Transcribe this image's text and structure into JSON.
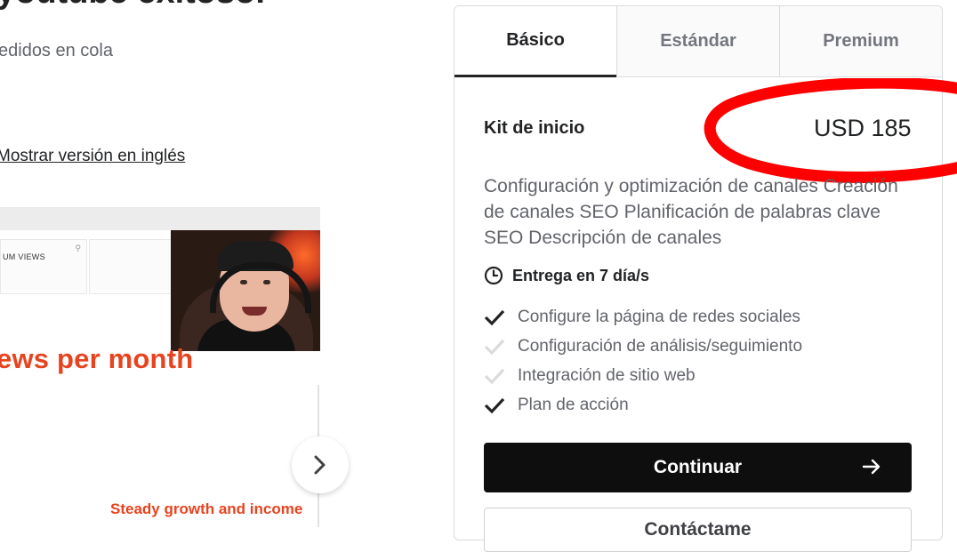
{
  "gig": {
    "title": "youtube exitoso.",
    "queue": "edidos en cola",
    "translate_link": "Mostrar versión en inglés"
  },
  "gallery": {
    "stat_label": "UM VIEWS",
    "headline": "ews per month",
    "subtitle": "Steady growth and income",
    "next_icon": "chevron-right-icon"
  },
  "package": {
    "tabs": [
      {
        "label": "Básico",
        "selected": true
      },
      {
        "label": "Estándar",
        "selected": false
      },
      {
        "label": "Premium",
        "selected": false
      }
    ],
    "name": "Kit de inicio",
    "price": "USD 185",
    "description": "Configuración y optimización de canales Creación de canales SEO Planificación de palabras clave SEO Descripción de canales",
    "delivery": "Entrega en 7 día/s",
    "features": [
      {
        "label": "Configure la página de redes sociales",
        "included": true
      },
      {
        "label": "Configuración de análisis/seguimiento",
        "included": false
      },
      {
        "label": "Integración de sitio web",
        "included": false
      },
      {
        "label": "Plan de acción",
        "included": true
      }
    ],
    "continue_label": "Continuar",
    "contact_label": "Contáctame"
  },
  "colors": {
    "accent_red": "#e8431f",
    "annotation_red": "#ff0000",
    "check_included": "#222325",
    "check_excluded": "#dadbdd"
  }
}
